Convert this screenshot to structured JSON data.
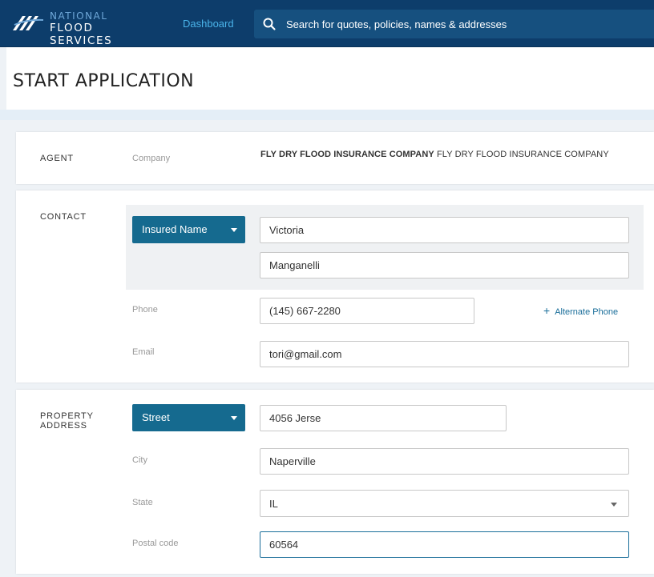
{
  "header": {
    "logo_line1": "NATIONAL",
    "logo_line2": "FLOOD SERVICES",
    "dashboard_link": "Dashboard",
    "search_placeholder": "Search for quotes, policies, names & addresses"
  },
  "page": {
    "title": "START APPLICATION"
  },
  "agent": {
    "section_label": "AGENT",
    "company_label": "Company",
    "company_name_bold": "FLY DRY FLOOD INSURANCE COMPANY",
    "company_name": "FLY DRY FLOOD INSURANCE COMPANY"
  },
  "contact": {
    "section_label": "CONTACT",
    "name_type_button": "Insured Name",
    "first_name": "Victoria",
    "last_name": "Manganelli",
    "phone_label": "Phone",
    "phone_value": "(145) 667-2280",
    "alternate_phone_link": "Alternate Phone",
    "email_label": "Email",
    "email_value": "tori@gmail.com"
  },
  "property_address": {
    "section_label_line1": "PROPERTY",
    "section_label_line2": "ADDRESS",
    "street_type_button": "Street",
    "street_value": "4056 Jerse",
    "city_label": "City",
    "city_value": "Naperville",
    "state_label": "State",
    "state_value": "IL",
    "postal_label": "Postal code",
    "postal_value": "60564"
  },
  "colors": {
    "topbar": "#0d3d6b",
    "accent_button": "#156a8f",
    "link": "#1a6e9a",
    "dashboard_link": "#4ab4ea"
  }
}
